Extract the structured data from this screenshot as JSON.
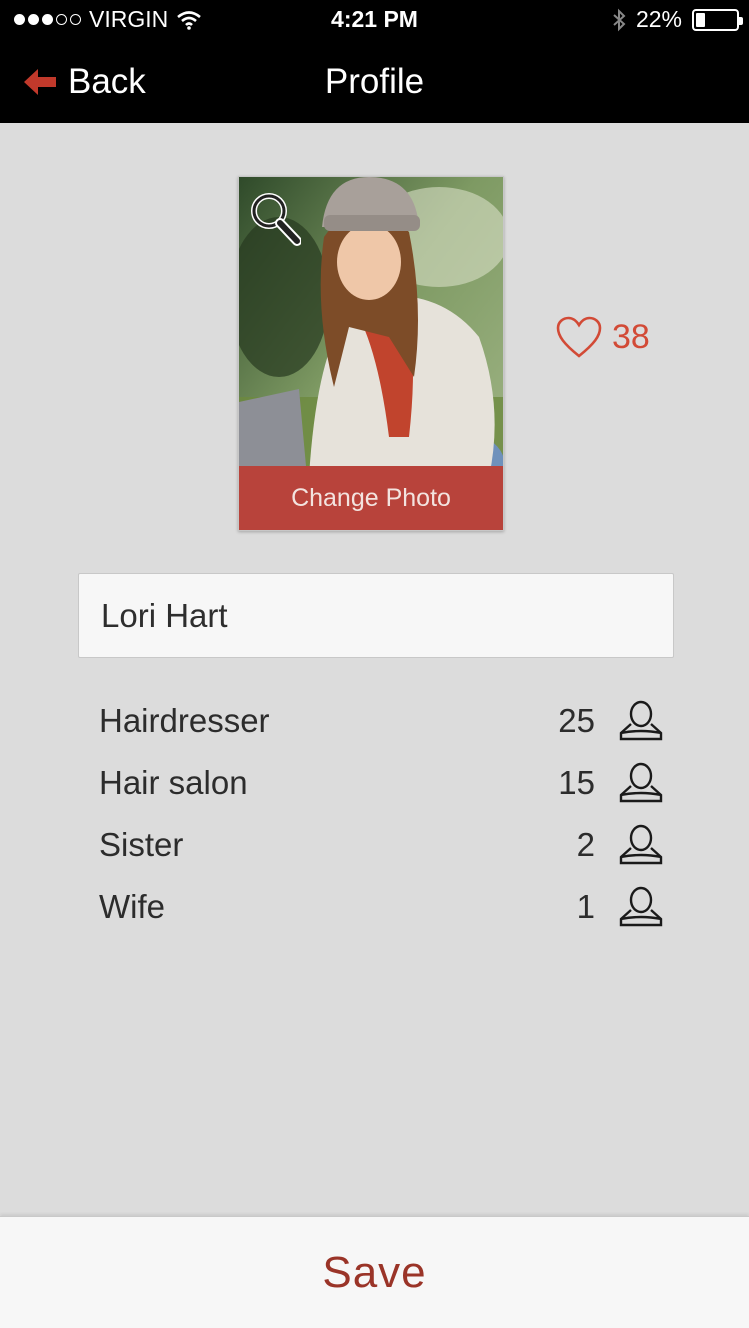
{
  "status_bar": {
    "carrier": "VIRGIN",
    "time": "4:21 PM",
    "battery_percent": "22%",
    "battery_level": 0.22,
    "signal_bars": 3,
    "signal_total": 5
  },
  "navbar": {
    "back_label": "Back",
    "title": "Profile"
  },
  "photo": {
    "change_label": "Change Photo"
  },
  "likes": {
    "count": "38"
  },
  "name_field": {
    "value": "Lori Hart"
  },
  "relationships": [
    {
      "label": "Hairdresser",
      "count": "25"
    },
    {
      "label": "Hair salon",
      "count": "15"
    },
    {
      "label": "Sister",
      "count": "2"
    },
    {
      "label": "Wife",
      "count": "1"
    }
  ],
  "footer": {
    "save_label": "Save"
  },
  "colors": {
    "accent": "#b8433b",
    "heart": "#d24a36",
    "save_text": "#9a3428",
    "background": "#dcdcdc"
  }
}
